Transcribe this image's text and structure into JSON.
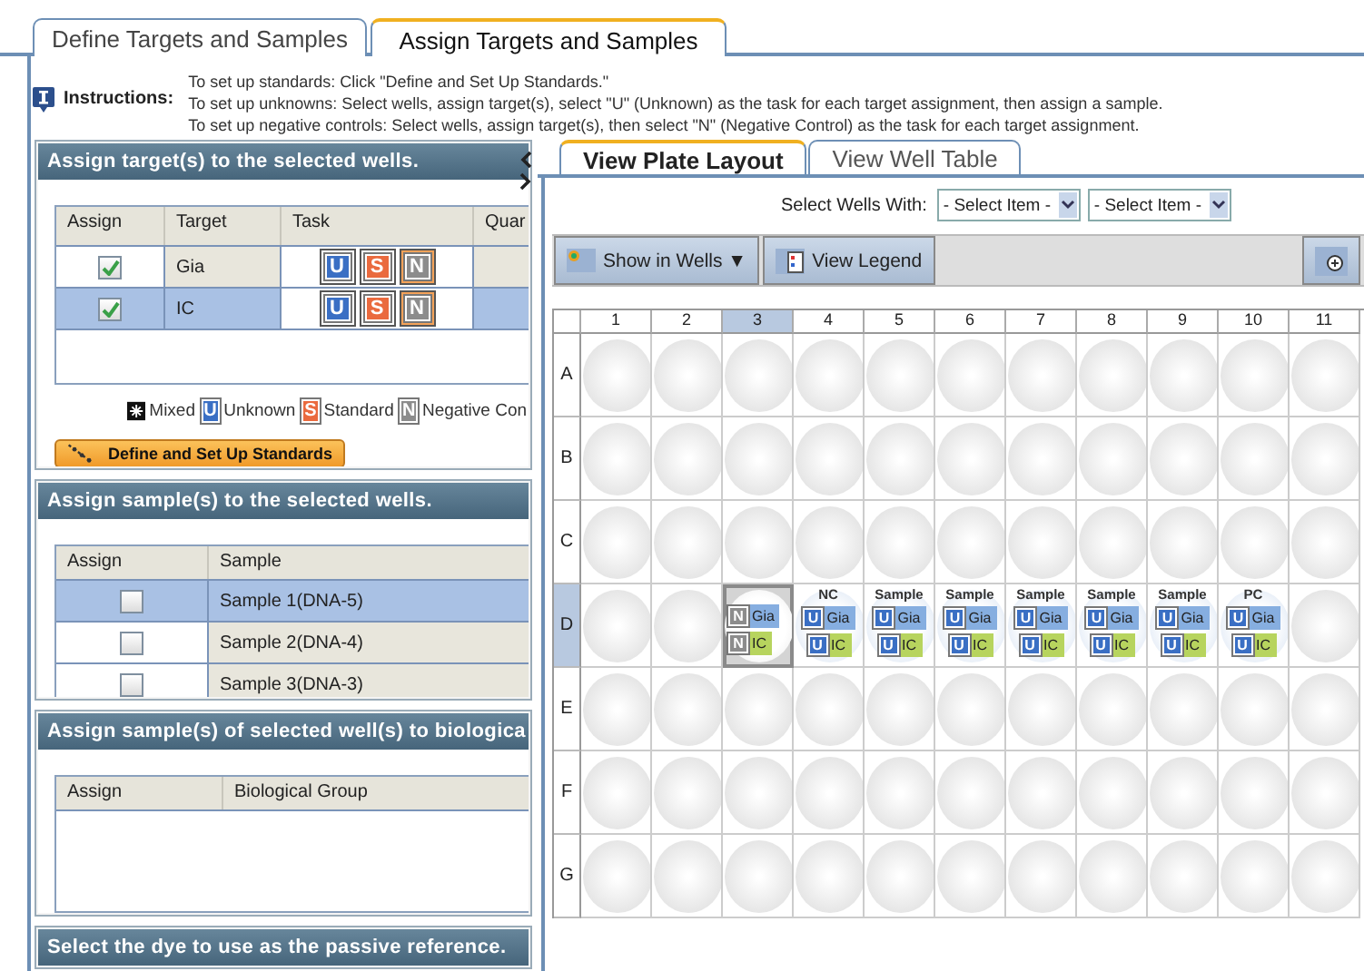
{
  "tabs": [
    {
      "label": "Define Targets and Samples",
      "selected": false
    },
    {
      "label": "Assign Targets and Samples",
      "selected": true
    }
  ],
  "instructions": {
    "label": "Instructions:",
    "lines": [
      "To set up standards: Click \"Define and Set Up Standards.\"",
      "To set up unknowns: Select wells, assign target(s), select \"U\" (Unknown) as the task for each target assignment, then assign a sample.",
      "To set up negative controls: Select wells, assign target(s), then select \"N\" (Negative Control) as the task for each target assignment."
    ]
  },
  "targets_section": {
    "title": "Assign target(s) to the selected wells.",
    "columns": [
      "Assign",
      "Target",
      "Task",
      "Quar"
    ],
    "rows": [
      {
        "checked": true,
        "selected": false,
        "target": "Gia",
        "tasks": [
          {
            "label": "U",
            "kind": "unknown",
            "selected": false
          },
          {
            "label": "S",
            "kind": "standard",
            "selected": false
          },
          {
            "label": "N",
            "kind": "negative",
            "selected": true
          }
        ]
      },
      {
        "checked": true,
        "selected": true,
        "target": "IC",
        "tasks": [
          {
            "label": "U",
            "kind": "unknown",
            "selected": false
          },
          {
            "label": "S",
            "kind": "standard",
            "selected": false
          },
          {
            "label": "N",
            "kind": "negative",
            "selected": true
          }
        ]
      }
    ],
    "legend": [
      {
        "kind": "mixed",
        "label": "Mixed"
      },
      {
        "kind": "unknown",
        "letter": "U",
        "label": "Unknown"
      },
      {
        "kind": "standard",
        "letter": "S",
        "label": "Standard"
      },
      {
        "kind": "negative",
        "letter": "N",
        "label": "Negative Con"
      }
    ],
    "button": "Define and Set Up Standards"
  },
  "samples_section": {
    "title": "Assign sample(s) to the selected wells.",
    "columns": [
      "Assign",
      "Sample"
    ],
    "rows": [
      {
        "checked": false,
        "selected": true,
        "sample": "Sample 1(DNA-5)"
      },
      {
        "checked": false,
        "selected": false,
        "sample": "Sample 2(DNA-4)"
      },
      {
        "checked": false,
        "selected": false,
        "sample": "Sample 3(DNA-3)"
      }
    ]
  },
  "groups_section": {
    "title": "Assign sample(s) of selected well(s) to biologica",
    "columns": [
      "Assign",
      "Biological Group"
    ]
  },
  "dye_section": {
    "title": "Select the dye to use as the passive reference."
  },
  "view_tabs": [
    {
      "label": "View Plate Layout",
      "selected": true
    },
    {
      "label": "View Well Table",
      "selected": false
    }
  ],
  "select_wells": {
    "label": "Select Wells With:",
    "dropdowns": [
      "- Select Item -",
      "- Select Item -"
    ]
  },
  "toolbar": {
    "show_in_wells": "Show in Wells ▼",
    "view_legend": "View Legend"
  },
  "plate": {
    "columns": [
      {
        "label": "1",
        "selected": false
      },
      {
        "label": "2",
        "selected": false
      },
      {
        "label": "3",
        "selected": true
      },
      {
        "label": "4",
        "selected": false
      },
      {
        "label": "5",
        "selected": false
      },
      {
        "label": "6",
        "selected": false
      },
      {
        "label": "7",
        "selected": false
      },
      {
        "label": "8",
        "selected": false
      },
      {
        "label": "9",
        "selected": false
      },
      {
        "label": "10",
        "selected": false
      },
      {
        "label": "11",
        "selected": false
      }
    ],
    "rows": [
      {
        "label": "A",
        "selected": false
      },
      {
        "label": "B",
        "selected": false
      },
      {
        "label": "C",
        "selected": false
      },
      {
        "label": "D",
        "selected": true,
        "wells": [
          {
            "selected": false
          },
          {
            "selected": false
          },
          {
            "selected": true,
            "targets": [
              {
                "task": "N",
                "kind": "negative",
                "name": "Gia"
              },
              {
                "task": "N",
                "kind": "negative",
                "name": "IC"
              }
            ]
          },
          {
            "selected": false,
            "label": "NC",
            "targets": [
              {
                "task": "U",
                "kind": "unknown",
                "name": "Gia"
              },
              {
                "task": "U",
                "kind": "unknown",
                "name": "IC"
              }
            ]
          },
          {
            "selected": false,
            "label": "Sample",
            "targets": [
              {
                "task": "U",
                "kind": "unknown",
                "name": "Gia"
              },
              {
                "task": "U",
                "kind": "unknown",
                "name": "IC"
              }
            ]
          },
          {
            "selected": false,
            "label": "Sample",
            "targets": [
              {
                "task": "U",
                "kind": "unknown",
                "name": "Gia"
              },
              {
                "task": "U",
                "kind": "unknown",
                "name": "IC"
              }
            ]
          },
          {
            "selected": false,
            "label": "Sample",
            "targets": [
              {
                "task": "U",
                "kind": "unknown",
                "name": "Gia"
              },
              {
                "task": "U",
                "kind": "unknown",
                "name": "IC"
              }
            ]
          },
          {
            "selected": false,
            "label": "Sample",
            "targets": [
              {
                "task": "U",
                "kind": "unknown",
                "name": "Gia"
              },
              {
                "task": "U",
                "kind": "unknown",
                "name": "IC"
              }
            ]
          },
          {
            "selected": false,
            "label": "Sample",
            "targets": [
              {
                "task": "U",
                "kind": "unknown",
                "name": "Gia"
              },
              {
                "task": "U",
                "kind": "unknown",
                "name": "IC"
              }
            ]
          },
          {
            "selected": false,
            "label": "PC",
            "targets": [
              {
                "task": "U",
                "kind": "unknown",
                "name": "Gia"
              },
              {
                "task": "U",
                "kind": "unknown",
                "name": "IC"
              }
            ]
          },
          {
            "selected": false
          }
        ]
      },
      {
        "label": "E",
        "selected": false
      },
      {
        "label": "F",
        "selected": false
      },
      {
        "label": "G",
        "selected": false
      }
    ]
  }
}
